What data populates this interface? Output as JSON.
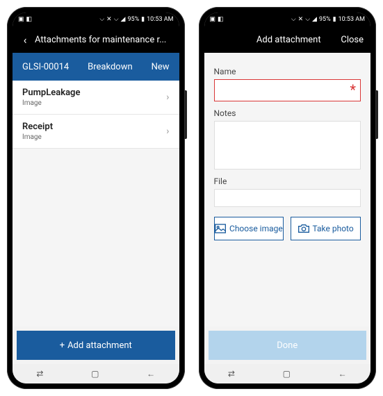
{
  "statusbar": {
    "battery_pct": "95%",
    "time": "10:53 AM"
  },
  "left_phone": {
    "appbar_title": "Attachments for maintenance r...",
    "context": {
      "id": "GLSI-00014",
      "type": "Breakdown",
      "status": "New"
    },
    "items": [
      {
        "name": "PumpLeakage",
        "type": "Image"
      },
      {
        "name": "Receipt",
        "type": "Image"
      }
    ],
    "bottom_btn": "Add attachment"
  },
  "right_phone": {
    "appbar_title": "Add attachment",
    "close_label": "Close",
    "labels": {
      "name": "Name",
      "notes": "Notes",
      "file": "File"
    },
    "btn_choose": "Choose image",
    "btn_photo": "Take photo",
    "done": "Done"
  }
}
